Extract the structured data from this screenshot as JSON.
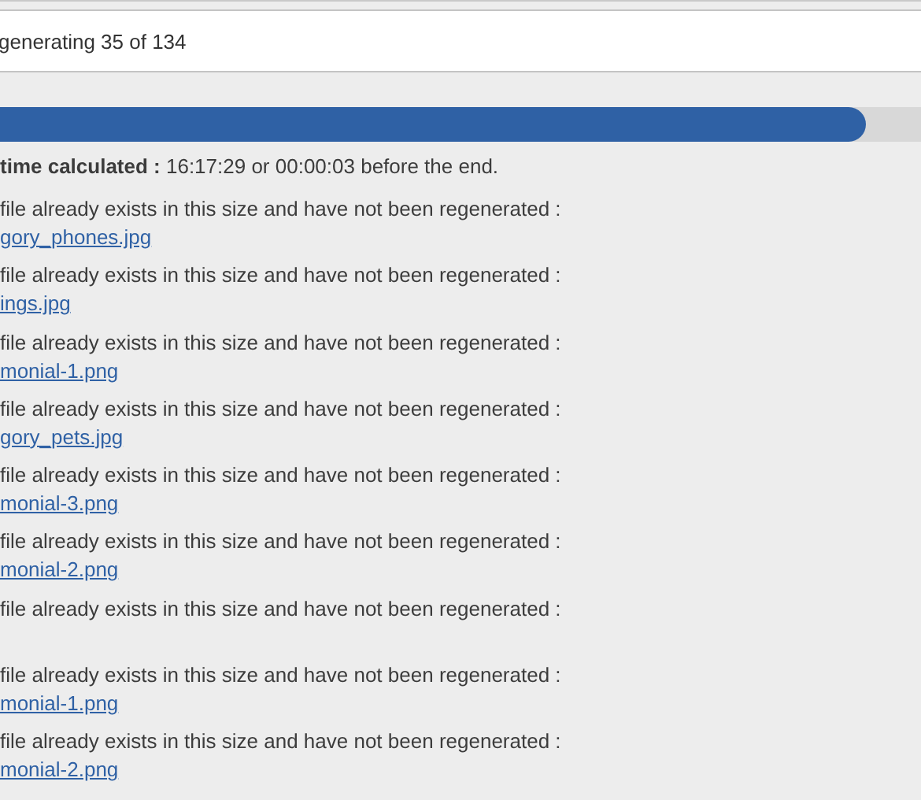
{
  "header": {
    "title": "generating 35 of 134"
  },
  "progress": {
    "level": 0.94
  },
  "estimate": "**time calculated :** 16:17:29 or 00:00:03 before the end.",
  "entries": [
    {
      "message": "file already exists in this size and have not been regenerated :",
      "link": "gory_phones.jpg"
    },
    {
      "message": "file already exists in this size and have not been regenerated :",
      "link": "ings.jpg"
    },
    {
      "message": "file already exists in this size and have not been regenerated :",
      "link": "monial-1.png"
    },
    {
      "message": "file already exists in this size and have not been regenerated :",
      "link": "gory_pets.jpg"
    },
    {
      "message": "file already exists in this size and have not been regenerated :",
      "link": "monial-3.png"
    },
    {
      "message": "file already exists in this size and have not been regenerated :",
      "link": "monial-2.png"
    },
    {
      "message": "file already exists in this size and have not been regenerated :"
    },
    {
      "message": "file already exists in this size and have not been regenerated :",
      "link": "monial-1.png"
    },
    {
      "message": "file already exists in this size and have not been regenerated :",
      "link": "monial-2.png"
    }
  ]
}
